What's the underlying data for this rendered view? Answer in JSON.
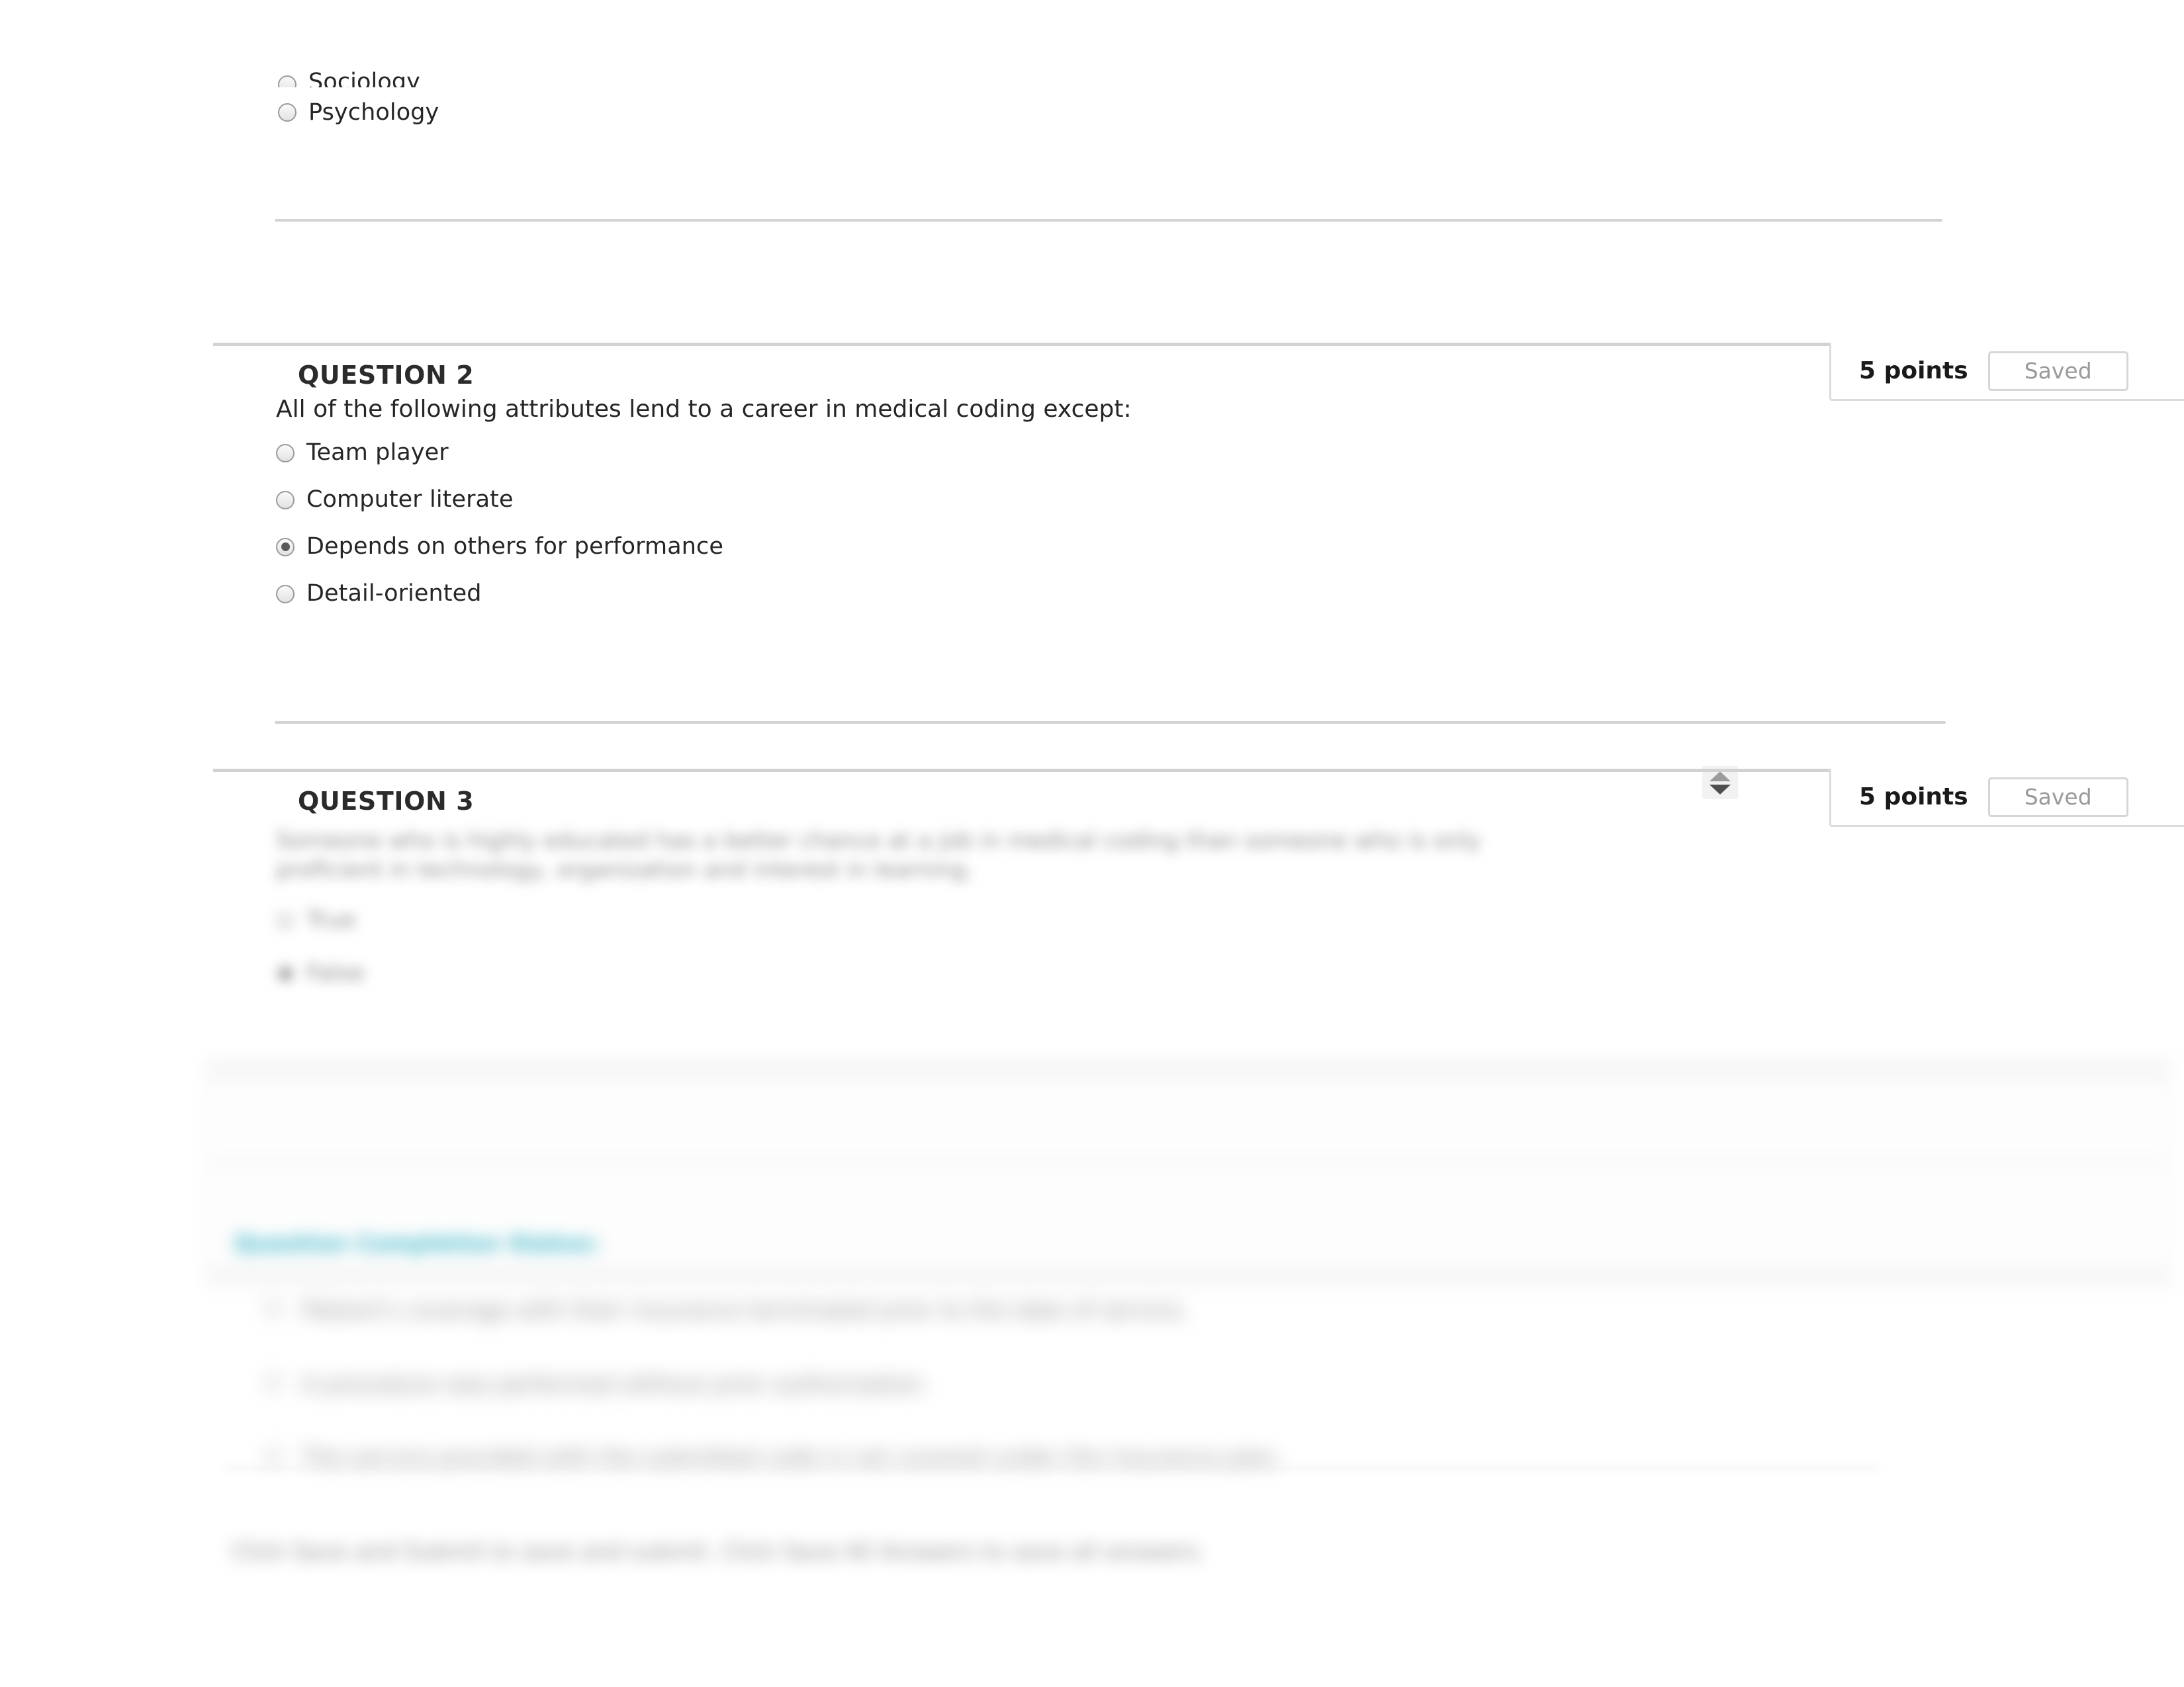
{
  "top_partial_question": {
    "options": [
      {
        "label": "Sociology",
        "selected": false,
        "clipped": true
      },
      {
        "label": "Psychology",
        "selected": false,
        "clipped": false
      }
    ]
  },
  "questions": [
    {
      "id": "q2",
      "title": "QUESTION 2",
      "points": "5 points",
      "save_status": "Saved",
      "text": "All of the following attributes lend to a career in medical coding except:",
      "has_spinner": true,
      "blurred": false,
      "options": [
        {
          "label": "Team player",
          "selected": false
        },
        {
          "label": "Computer literate",
          "selected": false
        },
        {
          "label": "Depends on others for performance",
          "selected": true
        },
        {
          "label": "Detail-oriented",
          "selected": false
        }
      ]
    },
    {
      "id": "q3",
      "title": "QUESTION 3",
      "points": "5 points",
      "save_status": "Saved",
      "text": "Someone who is highly educated has a better chance at a job in medical coding than someone who is only proficient in technology, organization and interest in learning.",
      "has_spinner": false,
      "blurred": true,
      "options": [
        {
          "label": "True",
          "selected": false
        },
        {
          "label": "False",
          "selected": true
        }
      ]
    }
  ],
  "status_section": {
    "heading": "Question Completion Status:",
    "blurred": true
  },
  "obscured_list": {
    "items": [
      "Patient's coverage with their insurance terminated prior to the date of service.",
      "A procedure was performed without prior authorization.",
      "The service provided with the submitted code is not covered under the insurance plan."
    ],
    "footer": "Click Save and Submit to save and submit. Click Save All Answers to save all answers."
  }
}
